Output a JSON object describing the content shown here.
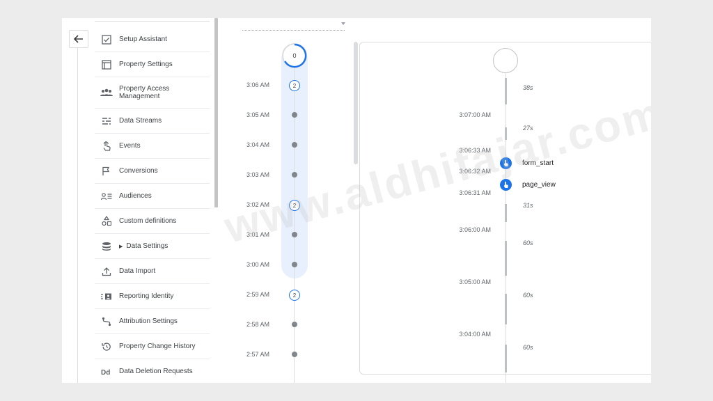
{
  "nav": {
    "items": [
      {
        "label": "Setup Assistant",
        "icon": "checkbox-icon"
      },
      {
        "label": "Property Settings",
        "icon": "window-icon"
      },
      {
        "label": "Property Access Management",
        "label2": "Management",
        "label1": "Property Access",
        "icon": "people-icon"
      },
      {
        "label": "Data Streams",
        "icon": "streams-icon"
      },
      {
        "label": "Events",
        "icon": "touch-icon"
      },
      {
        "label": "Conversions",
        "icon": "flag-icon"
      },
      {
        "label": "Audiences",
        "icon": "audience-icon"
      },
      {
        "label": "Custom definitions",
        "icon": "shapes-icon"
      },
      {
        "label": "Data Settings",
        "icon": "database-icon"
      },
      {
        "label": "Data Import",
        "icon": "upload-icon"
      },
      {
        "label": "Reporting Identity",
        "icon": "identity-icon"
      },
      {
        "label": "Attribution Settings",
        "icon": "attribution-icon"
      },
      {
        "label": "Property Change History",
        "icon": "history-icon"
      },
      {
        "label": "Data Deletion Requests",
        "icon": "dd-icon"
      }
    ]
  },
  "timeline": {
    "top_count": "0",
    "rows": [
      {
        "time": "3:06 AM",
        "badge": "2"
      },
      {
        "time": "3:05 AM",
        "badge": ""
      },
      {
        "time": "3:04 AM",
        "badge": ""
      },
      {
        "time": "3:03 AM",
        "badge": ""
      },
      {
        "time": "3:02 AM",
        "badge": "2"
      },
      {
        "time": "3:01 AM",
        "badge": ""
      },
      {
        "time": "3:00 AM",
        "badge": ""
      },
      {
        "time": "2:59 AM",
        "badge": "2"
      },
      {
        "time": "2:58 AM",
        "badge": ""
      },
      {
        "time": "2:57 AM",
        "badge": ""
      }
    ]
  },
  "detail": {
    "times": [
      "3:07:00 AM",
      "3:06:33 AM",
      "3:06:32 AM",
      "3:06:31 AM",
      "3:06:00 AM",
      "3:05:00 AM",
      "3:04:00 AM"
    ],
    "durations": [
      "38s",
      "27s",
      "31s",
      "60s",
      "60s",
      "60s"
    ],
    "events": [
      {
        "name": "form_start"
      },
      {
        "name": "page_view"
      }
    ]
  },
  "watermark": "www.aldhifajar.com",
  "colors": {
    "accent": "#1a73e8",
    "band": "#e8f0fe",
    "dot": "#80868b"
  }
}
